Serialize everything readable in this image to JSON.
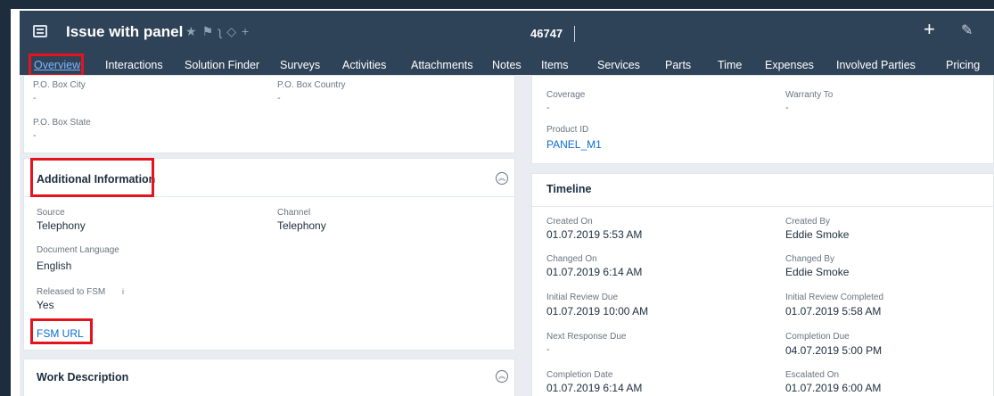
{
  "header": {
    "title": "Issue with panel",
    "ticket_id": "46747",
    "plus": "+",
    "pencil": "✎",
    "icons": [
      "star-icon",
      "flag-icon",
      "rss-icon",
      "tag-icon",
      "add-icon"
    ]
  },
  "tabs": [
    {
      "label": "Overview",
      "active": true
    },
    {
      "label": "Interactions"
    },
    {
      "label": "Solution Finder"
    },
    {
      "label": "Surveys"
    },
    {
      "label": "Activities"
    },
    {
      "label": "Attachments"
    },
    {
      "label": "Notes"
    },
    {
      "label": "Items"
    },
    {
      "label": "Services"
    },
    {
      "label": "Parts"
    },
    {
      "label": "Time"
    },
    {
      "label": "Expenses"
    },
    {
      "label": "Involved Parties"
    },
    {
      "label": "Pricing"
    }
  ],
  "address_card": {
    "po_box_city_label": "P.O. Box City",
    "po_box_city_value": "-",
    "po_box_country_label": "P.O. Box Country",
    "po_box_country_value": "-",
    "po_box_state_label": "P.O. Box State",
    "po_box_state_value": "-"
  },
  "product_card": {
    "coverage_label": "Coverage",
    "coverage_value": "-",
    "warranty_to_label": "Warranty To",
    "warranty_to_value": "-",
    "product_id_label": "Product ID",
    "product_id_value": "PANEL_M1"
  },
  "additional_info": {
    "title": "Additional Information",
    "source_label": "Source",
    "source_value": "Telephony",
    "channel_label": "Channel",
    "channel_value": "Telephony",
    "doc_lang_label": "Document Language",
    "doc_lang_value": "English",
    "released_label": "Released to  FSM",
    "released_info": "i",
    "released_value": "Yes",
    "fsm_url": "FSM URL"
  },
  "timeline": {
    "title": "Timeline",
    "created_on_label": "Created On",
    "created_on_value": "01.07.2019 5:53 AM",
    "created_by_label": "Created By",
    "created_by_value": "Eddie Smoke",
    "changed_on_label": "Changed On",
    "changed_on_value": "01.07.2019 6:14 AM",
    "changed_by_label": "Changed By",
    "changed_by_value": "Eddie Smoke",
    "initial_review_due_label": "Initial Review Due",
    "initial_review_due_value": "01.07.2019 10:00 AM",
    "initial_review_completed_label": "Initial Review Completed",
    "initial_review_completed_value": "01.07.2019 5:58 AM",
    "next_response_due_label": "Next Response Due",
    "next_response_due_value": "-",
    "completion_due_label": "Completion Due",
    "completion_due_value": "04.07.2019 5:00 PM",
    "completion_date_label": "Completion Date",
    "completion_date_value": "01.07.2019 6:14 AM",
    "escalated_on_label": "Escalated On",
    "escalated_on_value": "01.07.2019 6:00 AM"
  },
  "work_description": {
    "title": "Work Description"
  },
  "colors": {
    "header_bg": "#2f4358",
    "link": "#0a6ed1",
    "highlight": "#e4141e",
    "active_tab": "#7fb6ff"
  }
}
